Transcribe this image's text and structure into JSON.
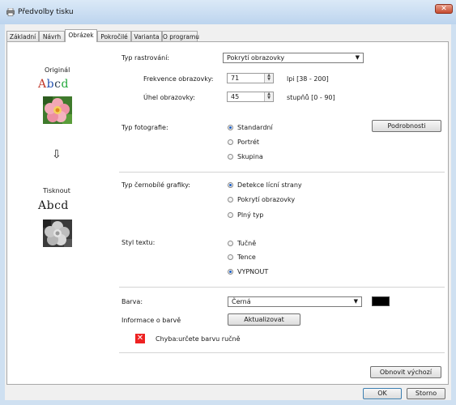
{
  "window": {
    "title": "Předvolby tisku",
    "close_glyph": "✕"
  },
  "tabs": [
    {
      "label": "Základní"
    },
    {
      "label": "Návrh"
    },
    {
      "label": "Obrázek"
    },
    {
      "label": "Pokročilé"
    },
    {
      "label": "Varianta"
    },
    {
      "label": "O programu"
    }
  ],
  "preview": {
    "original_label": "Originál",
    "original_text": [
      "A",
      "b",
      "c",
      "d"
    ],
    "arrow": "⇩",
    "print_label": "Tisknout",
    "print_text": "Abcd"
  },
  "halftone": {
    "label": "Typ rastrování:",
    "value": "Pokrytí obrazovky",
    "frequency_label": "Frekvence obrazovky:",
    "frequency_value": "71",
    "frequency_range": "lpi [38 - 200]",
    "angle_label": "Úhel obrazovky:",
    "angle_value": "45",
    "angle_range": "stupňů [0 - 90]"
  },
  "photo_type": {
    "label": "Typ fotografie:",
    "options": [
      "Standardní",
      "Portrét",
      "Skupina"
    ],
    "selected": 0,
    "details_button": "Podrobnosti"
  },
  "bw_graphics": {
    "label": "Typ černobílé grafiky:",
    "options": [
      "Detekce lícní strany",
      "Pokrytí obrazovky",
      "Plný typ"
    ],
    "selected": 0
  },
  "text_style": {
    "label": "Styl textu:",
    "options": [
      "Tučně",
      "Tence",
      "VYPNOUT"
    ],
    "selected": 2
  },
  "color": {
    "label": "Barva:",
    "value": "Černá",
    "swatch": "#000000",
    "info_label": "Informace o barvě",
    "update_button": "Aktualizovat",
    "error_text": "Chyba:určete barvu ručně"
  },
  "reset_button": "Obnovit výchozí",
  "footer": {
    "ok": "OK",
    "cancel": "Storno"
  }
}
